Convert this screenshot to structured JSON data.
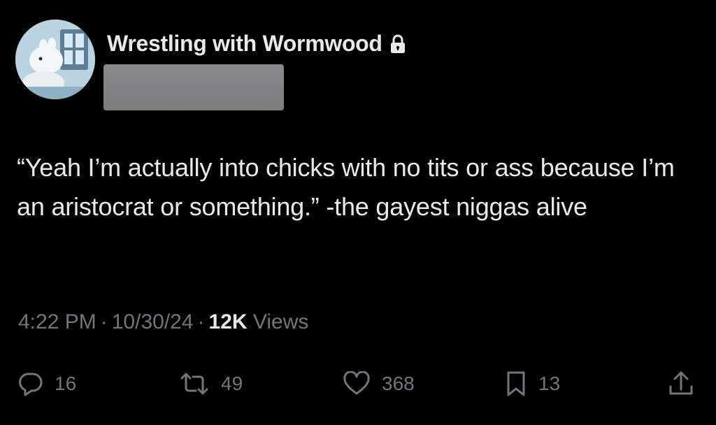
{
  "tweet": {
    "display_name": "Wrestling with Wormwood",
    "text": "“Yeah I’m actually into chicks with no tits or ass because I’m an aristocrat or something.” -the gayest niggas alive",
    "time": "4:22 PM",
    "date": "10/30/24",
    "separator": "·",
    "views_count": "12K",
    "views_label": "Views"
  },
  "actions": {
    "replies": "16",
    "retweets": "49",
    "likes": "368",
    "bookmarks": "13"
  },
  "icons": {
    "avatar": "avatar-image",
    "lock": "lock-icon",
    "reply": "reply-icon",
    "retweet": "retweet-icon",
    "like": "heart-icon",
    "bookmark": "bookmark-icon",
    "share": "share-icon"
  },
  "colors": {
    "background": "#000000",
    "text": "#e7e9ea",
    "muted": "#71767b",
    "redaction": "#858587"
  }
}
